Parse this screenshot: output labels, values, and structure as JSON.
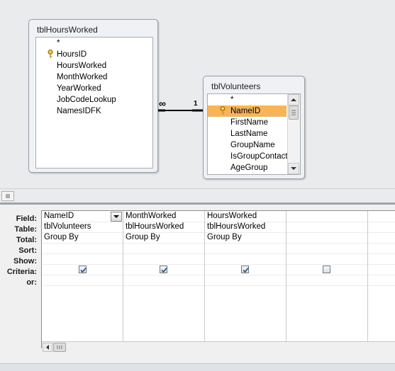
{
  "tables": [
    {
      "name": "tblHoursWorked",
      "fields": [
        "*",
        "HoursID",
        "HoursWorked",
        "MonthWorked",
        "YearWorked",
        "JobCodeLookup",
        "NamesIDFK"
      ],
      "key_field": "HoursID"
    },
    {
      "name": "tblVolunteers",
      "fields": [
        "*",
        "NameID",
        "FirstName",
        "LastName",
        "GroupName",
        "IsGroupContact",
        "AgeGroup"
      ],
      "key_field": "NameID",
      "selected_field": "NameID"
    }
  ],
  "relationship": {
    "many_label": "∞",
    "one_label": "1"
  },
  "row_labels": [
    "Field:",
    "Table:",
    "Total:",
    "Sort:",
    "Show:",
    "Criteria:",
    "or:"
  ],
  "columns": [
    {
      "field": "NameID",
      "table": "tblVolunteers",
      "total": "Group By",
      "show": true
    },
    {
      "field": "MonthWorked",
      "table": "tblHoursWorked",
      "total": "Group By",
      "show": true
    },
    {
      "field": "HoursWorked",
      "table": "tblHoursWorked",
      "total": "Group By",
      "show": true
    },
    {
      "field": "",
      "table": "",
      "total": "",
      "show": false
    },
    {
      "field": "",
      "table": "",
      "total": "",
      "show": false
    }
  ],
  "colors": {
    "selection": "#f7b55a",
    "check": "#1f4f8a"
  }
}
